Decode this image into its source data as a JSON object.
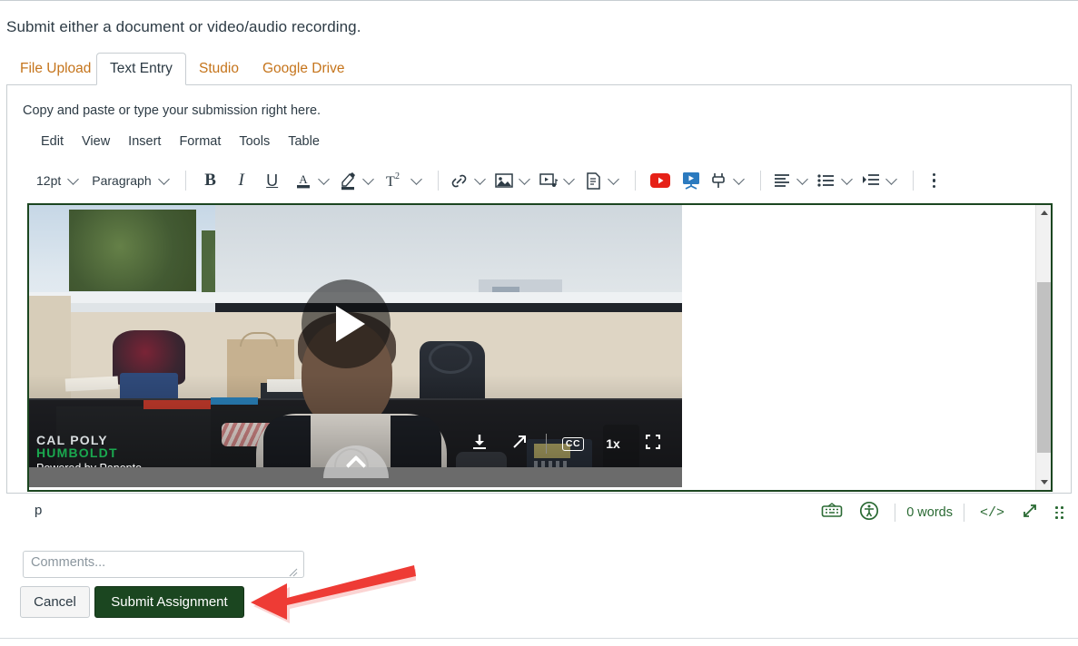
{
  "intro": {
    "text": "Submit either a document or video/audio recording."
  },
  "tabs": [
    {
      "label": "File Upload",
      "active": false
    },
    {
      "label": "Text Entry",
      "active": true
    },
    {
      "label": "Studio",
      "active": false
    },
    {
      "label": "Google Drive",
      "active": false
    }
  ],
  "panel": {
    "hint": "Copy and paste or type your submission right here."
  },
  "menubar": [
    {
      "label": "Edit"
    },
    {
      "label": "View"
    },
    {
      "label": "Insert"
    },
    {
      "label": "Format"
    },
    {
      "label": "Tools"
    },
    {
      "label": "Table"
    }
  ],
  "toolbar": {
    "font_size": "12pt",
    "block_format": "Paragraph",
    "bold": "B",
    "italic": "I",
    "underline": "U",
    "text_color": "A",
    "superscript": "T",
    "superscript_exp": "2",
    "icons": {
      "bold": "bold-icon",
      "italic": "italic-icon",
      "underline": "underline-icon",
      "text_color": "text-color-icon",
      "highlight": "highlight-color-icon",
      "superscript": "superscript-icon",
      "link": "link-icon",
      "image": "image-icon",
      "media": "media-icon",
      "document": "document-icon",
      "youtube": "youtube-icon",
      "studio": "studio-icon",
      "apps": "apps-plugin-icon",
      "align": "align-left-icon",
      "list": "bulleted-list-icon",
      "indent": "indent-icon",
      "more": "kebab-more-icon"
    }
  },
  "editor": {
    "video": {
      "brand_line1": "CAL POLY",
      "brand_line2": "HUMBOLDT",
      "brand_line3": "Powered by Panopto",
      "playback_speed": "1x",
      "cc_label": "CC",
      "controls": [
        {
          "name": "download-icon"
        },
        {
          "name": "share-open-icon"
        },
        {
          "name": "captions-cc-icon"
        },
        {
          "name": "playback-speed"
        },
        {
          "name": "fullscreen-icon"
        }
      ]
    },
    "scrollbar": {
      "up": "scroll-up-arrow",
      "down": "scroll-down-arrow"
    }
  },
  "statusbar": {
    "path": "p",
    "word_count": "0 words",
    "code_label": "</>",
    "icons": {
      "keyboard": "keyboard-shortcuts-icon",
      "accessibility": "accessibility-checker-icon",
      "html_editor": "html-editor-icon",
      "fullscreen": "fullscreen-expand-icon",
      "resize": "resize-grip-icon"
    }
  },
  "comments": {
    "placeholder": "Comments...",
    "value": ""
  },
  "actions": {
    "cancel": "Cancel",
    "submit": "Submit Assignment"
  },
  "annotation": {
    "arrow": "red-arrow-pointing-to-submit",
    "color": "#ee3b35"
  },
  "colors": {
    "tab_link": "#c5741b",
    "primary_green": "#1b4620",
    "status_green": "#2a6a33",
    "text": "#2d3b45",
    "border": "#c7cdd1"
  }
}
